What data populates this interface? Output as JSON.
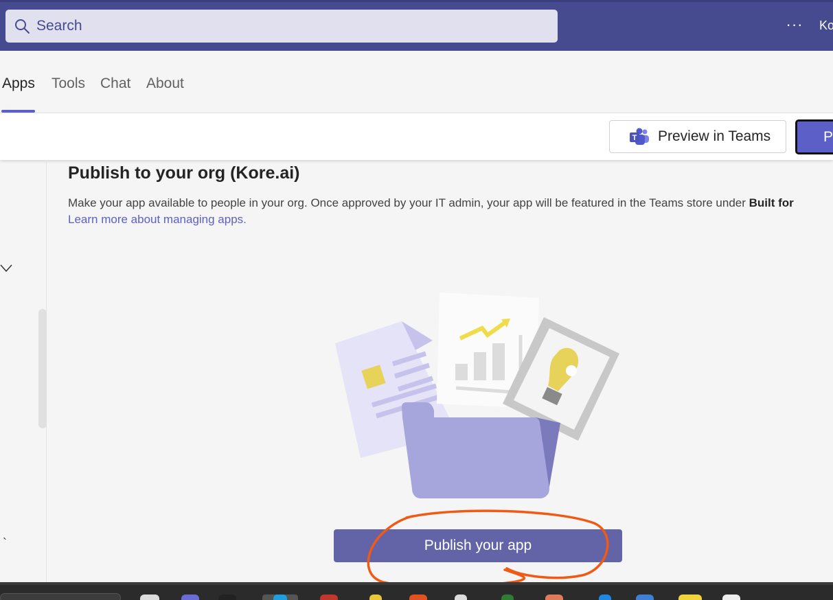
{
  "titlebar": {
    "search_placeholder": "Search",
    "more_label": "···",
    "user_label": "Ko"
  },
  "tabs": [
    {
      "label": "Apps",
      "active": true
    },
    {
      "label": "Tools",
      "active": false
    },
    {
      "label": "Chat",
      "active": false
    },
    {
      "label": "About",
      "active": false
    }
  ],
  "toolbar": {
    "preview_label": "Preview in Teams",
    "primary_label": "Pu"
  },
  "leftrail": {
    "tick_label": "`"
  },
  "content": {
    "heading": "Publish to your org (Kore.ai)",
    "description": "Make your app available to people in your org. Once approved by your IT admin, your app will be featured in the Teams store under ",
    "description_bold": "Built for",
    "learn_more": "Learn more about managing apps.",
    "publish_button": "Publish your app"
  },
  "colors": {
    "titlebar": "#464a8f",
    "accent": "#5b5fc7",
    "publish_button": "#6264a7",
    "annotation": "#f05a14"
  },
  "icons": [
    "search-icon",
    "more-icon",
    "teams-icon",
    "chevron-down-icon"
  ]
}
